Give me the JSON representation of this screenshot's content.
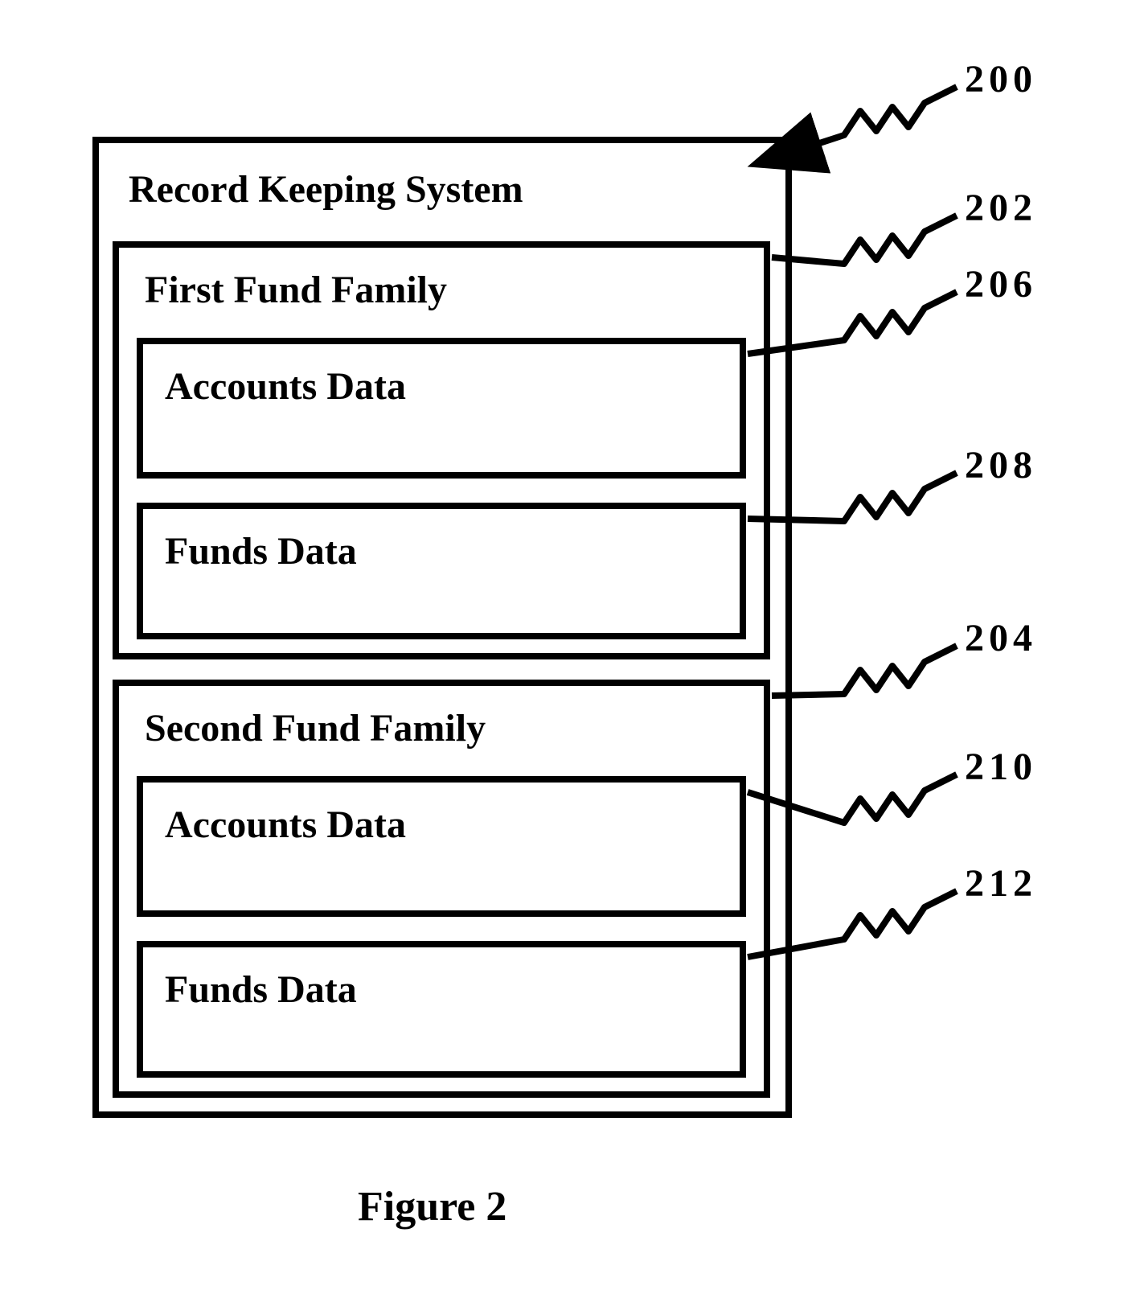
{
  "diagram": {
    "outer": {
      "title": "Record Keeping System",
      "ref": "200"
    },
    "family1": {
      "title": "First Fund Family",
      "ref": "202",
      "accounts": {
        "title": "Accounts Data",
        "ref": "206"
      },
      "funds": {
        "title": "Funds Data",
        "ref": "208"
      }
    },
    "family2": {
      "title": "Second Fund Family",
      "ref": "204",
      "accounts": {
        "title": "Accounts Data",
        "ref": "210"
      },
      "funds": {
        "title": "Funds Data",
        "ref": "212"
      }
    }
  },
  "caption": "Figure 2"
}
